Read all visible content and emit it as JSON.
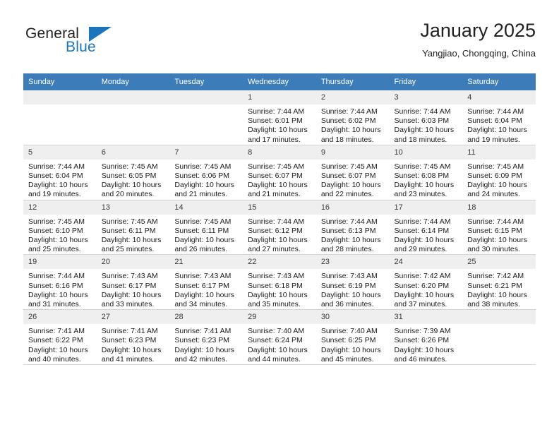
{
  "brand": {
    "name_part1": "General",
    "name_part2": "Blue",
    "flag_icon": "blue-flag-icon"
  },
  "header": {
    "title": "January 2025",
    "subtitle": "Yangjiao, Chongqing, China"
  },
  "theme": {
    "header_bg": "#3c7cb9",
    "header_text": "#ffffff",
    "daynum_bg": "#efefef",
    "brand_blue": "#1b75bb",
    "grid_line": "#cfcfcf"
  },
  "calendar": {
    "weekday_headers": [
      "Sunday",
      "Monday",
      "Tuesday",
      "Wednesday",
      "Thursday",
      "Friday",
      "Saturday"
    ],
    "weeks": [
      [
        {
          "day": "",
          "empty": true
        },
        {
          "day": "",
          "empty": true
        },
        {
          "day": "",
          "empty": true
        },
        {
          "day": "1",
          "sunrise": "Sunrise: 7:44 AM",
          "sunset": "Sunset: 6:01 PM",
          "daylight": "Daylight: 10 hours and 17 minutes."
        },
        {
          "day": "2",
          "sunrise": "Sunrise: 7:44 AM",
          "sunset": "Sunset: 6:02 PM",
          "daylight": "Daylight: 10 hours and 18 minutes."
        },
        {
          "day": "3",
          "sunrise": "Sunrise: 7:44 AM",
          "sunset": "Sunset: 6:03 PM",
          "daylight": "Daylight: 10 hours and 18 minutes."
        },
        {
          "day": "4",
          "sunrise": "Sunrise: 7:44 AM",
          "sunset": "Sunset: 6:04 PM",
          "daylight": "Daylight: 10 hours and 19 minutes."
        }
      ],
      [
        {
          "day": "5",
          "sunrise": "Sunrise: 7:44 AM",
          "sunset": "Sunset: 6:04 PM",
          "daylight": "Daylight: 10 hours and 19 minutes."
        },
        {
          "day": "6",
          "sunrise": "Sunrise: 7:45 AM",
          "sunset": "Sunset: 6:05 PM",
          "daylight": "Daylight: 10 hours and 20 minutes."
        },
        {
          "day": "7",
          "sunrise": "Sunrise: 7:45 AM",
          "sunset": "Sunset: 6:06 PM",
          "daylight": "Daylight: 10 hours and 21 minutes."
        },
        {
          "day": "8",
          "sunrise": "Sunrise: 7:45 AM",
          "sunset": "Sunset: 6:07 PM",
          "daylight": "Daylight: 10 hours and 21 minutes."
        },
        {
          "day": "9",
          "sunrise": "Sunrise: 7:45 AM",
          "sunset": "Sunset: 6:07 PM",
          "daylight": "Daylight: 10 hours and 22 minutes."
        },
        {
          "day": "10",
          "sunrise": "Sunrise: 7:45 AM",
          "sunset": "Sunset: 6:08 PM",
          "daylight": "Daylight: 10 hours and 23 minutes."
        },
        {
          "day": "11",
          "sunrise": "Sunrise: 7:45 AM",
          "sunset": "Sunset: 6:09 PM",
          "daylight": "Daylight: 10 hours and 24 minutes."
        }
      ],
      [
        {
          "day": "12",
          "sunrise": "Sunrise: 7:45 AM",
          "sunset": "Sunset: 6:10 PM",
          "daylight": "Daylight: 10 hours and 25 minutes."
        },
        {
          "day": "13",
          "sunrise": "Sunrise: 7:45 AM",
          "sunset": "Sunset: 6:11 PM",
          "daylight": "Daylight: 10 hours and 25 minutes."
        },
        {
          "day": "14",
          "sunrise": "Sunrise: 7:45 AM",
          "sunset": "Sunset: 6:11 PM",
          "daylight": "Daylight: 10 hours and 26 minutes."
        },
        {
          "day": "15",
          "sunrise": "Sunrise: 7:44 AM",
          "sunset": "Sunset: 6:12 PM",
          "daylight": "Daylight: 10 hours and 27 minutes."
        },
        {
          "day": "16",
          "sunrise": "Sunrise: 7:44 AM",
          "sunset": "Sunset: 6:13 PM",
          "daylight": "Daylight: 10 hours and 28 minutes."
        },
        {
          "day": "17",
          "sunrise": "Sunrise: 7:44 AM",
          "sunset": "Sunset: 6:14 PM",
          "daylight": "Daylight: 10 hours and 29 minutes."
        },
        {
          "day": "18",
          "sunrise": "Sunrise: 7:44 AM",
          "sunset": "Sunset: 6:15 PM",
          "daylight": "Daylight: 10 hours and 30 minutes."
        }
      ],
      [
        {
          "day": "19",
          "sunrise": "Sunrise: 7:44 AM",
          "sunset": "Sunset: 6:16 PM",
          "daylight": "Daylight: 10 hours and 31 minutes."
        },
        {
          "day": "20",
          "sunrise": "Sunrise: 7:43 AM",
          "sunset": "Sunset: 6:17 PM",
          "daylight": "Daylight: 10 hours and 33 minutes."
        },
        {
          "day": "21",
          "sunrise": "Sunrise: 7:43 AM",
          "sunset": "Sunset: 6:17 PM",
          "daylight": "Daylight: 10 hours and 34 minutes."
        },
        {
          "day": "22",
          "sunrise": "Sunrise: 7:43 AM",
          "sunset": "Sunset: 6:18 PM",
          "daylight": "Daylight: 10 hours and 35 minutes."
        },
        {
          "day": "23",
          "sunrise": "Sunrise: 7:43 AM",
          "sunset": "Sunset: 6:19 PM",
          "daylight": "Daylight: 10 hours and 36 minutes."
        },
        {
          "day": "24",
          "sunrise": "Sunrise: 7:42 AM",
          "sunset": "Sunset: 6:20 PM",
          "daylight": "Daylight: 10 hours and 37 minutes."
        },
        {
          "day": "25",
          "sunrise": "Sunrise: 7:42 AM",
          "sunset": "Sunset: 6:21 PM",
          "daylight": "Daylight: 10 hours and 38 minutes."
        }
      ],
      [
        {
          "day": "26",
          "sunrise": "Sunrise: 7:41 AM",
          "sunset": "Sunset: 6:22 PM",
          "daylight": "Daylight: 10 hours and 40 minutes."
        },
        {
          "day": "27",
          "sunrise": "Sunrise: 7:41 AM",
          "sunset": "Sunset: 6:23 PM",
          "daylight": "Daylight: 10 hours and 41 minutes."
        },
        {
          "day": "28",
          "sunrise": "Sunrise: 7:41 AM",
          "sunset": "Sunset: 6:23 PM",
          "daylight": "Daylight: 10 hours and 42 minutes."
        },
        {
          "day": "29",
          "sunrise": "Sunrise: 7:40 AM",
          "sunset": "Sunset: 6:24 PM",
          "daylight": "Daylight: 10 hours and 44 minutes."
        },
        {
          "day": "30",
          "sunrise": "Sunrise: 7:40 AM",
          "sunset": "Sunset: 6:25 PM",
          "daylight": "Daylight: 10 hours and 45 minutes."
        },
        {
          "day": "31",
          "sunrise": "Sunrise: 7:39 AM",
          "sunset": "Sunset: 6:26 PM",
          "daylight": "Daylight: 10 hours and 46 minutes."
        },
        {
          "day": "",
          "empty": true
        }
      ]
    ]
  }
}
